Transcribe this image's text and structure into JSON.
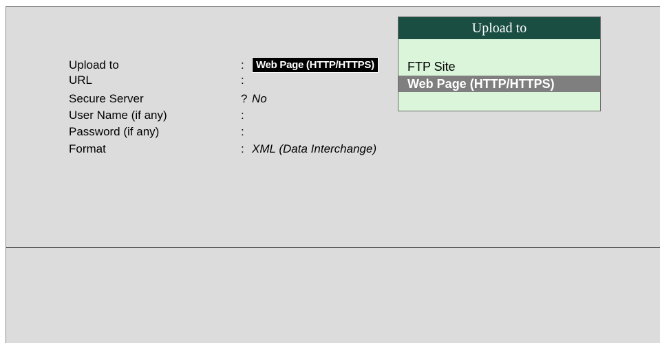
{
  "form": {
    "rows": [
      {
        "label": "Upload to",
        "sep": ":",
        "value": "Web Page (HTTP/HTTPS)"
      },
      {
        "label": "URL",
        "sep": ":",
        "value": ""
      },
      {
        "label": "Secure Server",
        "sep": "?",
        "value": "No"
      },
      {
        "label": "User Name (if any)",
        "sep": ":",
        "value": ""
      },
      {
        "label": "Password (if any)",
        "sep": ":",
        "value": ""
      },
      {
        "label": "Format",
        "sep": ":",
        "value": "XML (Data Interchange)"
      }
    ]
  },
  "popup": {
    "title": "Upload to",
    "options": [
      "FTP Site",
      "Web Page (HTTP/HTTPS)"
    ],
    "selected_index": 1
  },
  "colors": {
    "background": "#dcdcdc",
    "popup_title_bg": "#1a4e42",
    "popup_bg": "#daf5da",
    "selection_bg": "#7f7f7f",
    "field_highlight_bg": "#000000"
  }
}
